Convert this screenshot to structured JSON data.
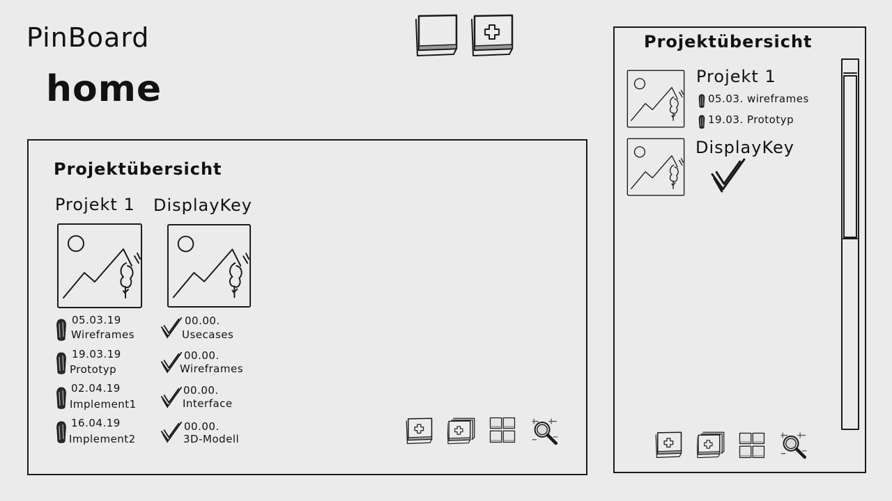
{
  "app": {
    "title": "PinBoard",
    "page": "home"
  },
  "top_toolbar": [
    {
      "icon": "blank-card-icon"
    },
    {
      "icon": "add-card-icon"
    }
  ],
  "main": {
    "heading": "Projektübersicht",
    "projects": [
      {
        "name": "Projekt 1",
        "thumbnail": "image-placeholder-icon",
        "items": [
          {
            "icon": "pin-icon",
            "date": "05.03.19",
            "label": "Wireframes"
          },
          {
            "icon": "pin-icon",
            "date": "19.03.19",
            "label": "Prototyp"
          },
          {
            "icon": "pin-icon",
            "date": "02.04.19",
            "label": "Implement1"
          },
          {
            "icon": "pin-icon",
            "date": "16.04.19",
            "label": "Implement2"
          }
        ]
      },
      {
        "name": "DisplayKey",
        "thumbnail": "image-placeholder-icon",
        "items": [
          {
            "icon": "checkmark-icon",
            "date": "00.00.",
            "label": "Usecases"
          },
          {
            "icon": "checkmark-icon",
            "date": "00.00.",
            "label": "Wireframes"
          },
          {
            "icon": "checkmark-icon",
            "date": "00.00.",
            "label": "Interface"
          },
          {
            "icon": "checkmark-icon",
            "date": "00.00.",
            "label": "3D-Modell"
          }
        ]
      }
    ],
    "toolbar": [
      "add-card-icon",
      "add-stack-icon",
      "grid-view-icon",
      "search-icon"
    ]
  },
  "sidebar": {
    "heading": "Projektübersicht",
    "projects": [
      {
        "name": "Projekt 1",
        "items": [
          {
            "icon": "pin-icon",
            "text": "05.03. wireframes"
          },
          {
            "icon": "pin-icon",
            "text": "19.03. Prototyp"
          }
        ]
      },
      {
        "name": "DisplayKey",
        "status_icon": "checkmark-icon"
      }
    ],
    "toolbar": [
      "add-card-icon",
      "add-stack-icon",
      "grid-view-icon",
      "search-icon"
    ]
  }
}
